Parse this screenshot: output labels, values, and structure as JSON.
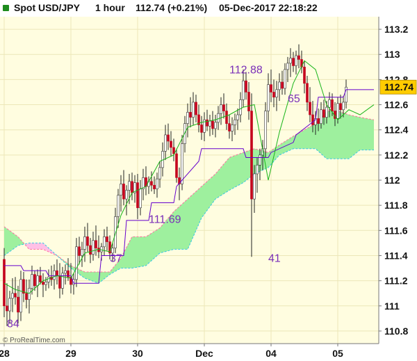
{
  "header": {
    "instrument": "Spot USD/JPY",
    "timeframe": "1 hour",
    "quote": "112.74 (+0.21%)",
    "datetime": "05-Dec-2017 22:18:22",
    "badge_color": "#1e8b1e"
  },
  "watermark": "© ProRealTime.com",
  "colors": {
    "background": "#fffde0",
    "bull": "#ffffff",
    "bear": "#c4001c",
    "tenkan": "#6600cc",
    "kijun": "#1ab51a",
    "cloud_bull": "#9ef09e",
    "cloud_bear": "#ffc0e6",
    "label": "#7a2fb8",
    "price_tag": "#ffcc00"
  },
  "chart_data": {
    "type": "candlestick",
    "ylim": [
      110.7,
      113.3
    ],
    "yticks": [
      113.2,
      113,
      112.8,
      112.6,
      112.4,
      112.2,
      112,
      111.8,
      111.6,
      111.4,
      111.2,
      111,
      110.8
    ],
    "xlabels": [
      {
        "text": "28",
        "i": 0
      },
      {
        "text": "29",
        "i": 24
      },
      {
        "text": "30",
        "i": 48
      },
      {
        "text": "Dec",
        "i": 72
      },
      {
        "text": "04",
        "i": 96
      },
      {
        "text": "05",
        "i": 120
      }
    ],
    "last_price": "112.74",
    "annotations": [
      {
        "text": "84",
        "i": 1,
        "y": 110.83
      },
      {
        "text": "37",
        "i": 38,
        "y": 111.35
      },
      {
        "text": "111.69",
        "i": 52,
        "y": 111.66
      },
      {
        "text": "112.88",
        "i": 81,
        "y": 112.85
      },
      {
        "text": "41",
        "i": 95,
        "y": 111.35
      },
      {
        "text": "65",
        "i": 102,
        "y": 112.62
      }
    ],
    "candles": [
      [
        111.37,
        111.46,
        110.91,
        111.0
      ],
      [
        111.0,
        111.18,
        110.84,
        110.96
      ],
      [
        110.96,
        111.12,
        110.86,
        111.06
      ],
      [
        111.06,
        111.22,
        110.95,
        111.1
      ],
      [
        111.1,
        111.23,
        111.01,
        111.07
      ],
      [
        111.07,
        111.16,
        110.86,
        110.95
      ],
      [
        110.95,
        111.28,
        110.88,
        111.21
      ],
      [
        111.21,
        111.27,
        111.03,
        111.1
      ],
      [
        111.1,
        111.21,
        110.98,
        111.05
      ],
      [
        111.05,
        111.21,
        110.94,
        111.14
      ],
      [
        111.14,
        111.32,
        111.09,
        111.25
      ],
      [
        111.25,
        111.28,
        111.12,
        111.16
      ],
      [
        111.16,
        111.29,
        111.07,
        111.24
      ],
      [
        111.24,
        111.31,
        111.17,
        111.19
      ],
      [
        111.19,
        111.26,
        111.07,
        111.17
      ],
      [
        111.17,
        111.23,
        111.12,
        111.19
      ],
      [
        111.19,
        111.29,
        111.14,
        111.23
      ],
      [
        111.23,
        111.32,
        111.16,
        111.21
      ],
      [
        111.21,
        111.33,
        111.13,
        111.28
      ],
      [
        111.28,
        111.37,
        111.17,
        111.24
      ],
      [
        111.24,
        111.34,
        111.06,
        111.14
      ],
      [
        111.14,
        111.31,
        111.09,
        111.26
      ],
      [
        111.26,
        111.33,
        111.17,
        111.28
      ],
      [
        111.28,
        111.38,
        111.2,
        111.23
      ],
      [
        111.23,
        111.34,
        111.1,
        111.17
      ],
      [
        111.17,
        111.26,
        111.09,
        111.21
      ],
      [
        111.21,
        111.54,
        111.15,
        111.47
      ],
      [
        111.47,
        111.55,
        111.33,
        111.4
      ],
      [
        111.4,
        111.51,
        111.31,
        111.45
      ],
      [
        111.45,
        111.63,
        111.35,
        111.55
      ],
      [
        111.55,
        111.66,
        111.43,
        111.48
      ],
      [
        111.48,
        111.54,
        111.34,
        111.41
      ],
      [
        111.41,
        111.59,
        111.36,
        111.52
      ],
      [
        111.52,
        111.64,
        111.4,
        111.46
      ],
      [
        111.46,
        111.56,
        111.38,
        111.43
      ],
      [
        111.43,
        111.5,
        111.36,
        111.47
      ],
      [
        111.47,
        111.61,
        111.4,
        111.55
      ],
      [
        111.55,
        111.63,
        111.44,
        111.51
      ],
      [
        111.51,
        111.56,
        111.37,
        111.42
      ],
      [
        111.42,
        111.5,
        111.35,
        111.46
      ],
      [
        111.46,
        111.78,
        111.42,
        111.71
      ],
      [
        111.71,
        111.93,
        111.62,
        111.88
      ],
      [
        111.88,
        112.04,
        111.75,
        111.97
      ],
      [
        111.97,
        112.08,
        111.8,
        111.85
      ],
      [
        111.85,
        111.96,
        111.72,
        111.92
      ],
      [
        111.92,
        112.05,
        111.81,
        111.99
      ],
      [
        111.99,
        112.06,
        111.84,
        111.9
      ],
      [
        111.9,
        112.04,
        111.82,
        111.98
      ],
      [
        111.98,
        112.05,
        111.69,
        111.78
      ],
      [
        111.78,
        112.0,
        111.72,
        111.93
      ],
      [
        111.93,
        112.09,
        111.84,
        112.02
      ],
      [
        112.02,
        112.11,
        111.88,
        111.95
      ],
      [
        111.95,
        112.03,
        111.89,
        111.99
      ],
      [
        111.99,
        112.07,
        111.91,
        111.96
      ],
      [
        111.96,
        112.03,
        111.89,
        111.93
      ],
      [
        111.93,
        112.06,
        111.86,
        112.01
      ],
      [
        112.01,
        112.15,
        111.94,
        112.1
      ],
      [
        112.1,
        112.3,
        112.03,
        112.23
      ],
      [
        112.23,
        112.44,
        112.16,
        112.36
      ],
      [
        112.36,
        112.45,
        112.24,
        112.31
      ],
      [
        112.31,
        112.39,
        112.19,
        112.26
      ],
      [
        112.26,
        112.33,
        112.15,
        112.21
      ],
      [
        112.21,
        112.25,
        111.98,
        112.02
      ],
      [
        112.02,
        112.1,
        111.84,
        111.97
      ],
      [
        111.97,
        112.36,
        111.92,
        112.29
      ],
      [
        112.29,
        112.51,
        112.22,
        112.45
      ],
      [
        112.45,
        112.61,
        112.34,
        112.54
      ],
      [
        112.54,
        112.66,
        112.42,
        112.5
      ],
      [
        112.5,
        112.7,
        112.44,
        112.62
      ],
      [
        112.62,
        112.68,
        112.46,
        112.52
      ],
      [
        112.52,
        112.6,
        112.38,
        112.44
      ],
      [
        112.44,
        112.51,
        112.32,
        112.38
      ],
      [
        112.38,
        112.54,
        112.31,
        112.48
      ],
      [
        112.48,
        112.56,
        112.39,
        112.43
      ],
      [
        112.43,
        112.52,
        112.35,
        112.47
      ],
      [
        112.47,
        112.55,
        112.36,
        112.41
      ],
      [
        112.41,
        112.52,
        112.34,
        112.46
      ],
      [
        112.46,
        112.59,
        112.4,
        112.53
      ],
      [
        112.53,
        112.66,
        112.44,
        112.6
      ],
      [
        112.6,
        112.69,
        112.49,
        112.55
      ],
      [
        112.55,
        112.61,
        112.4,
        112.45
      ],
      [
        112.45,
        112.52,
        112.33,
        112.39
      ],
      [
        112.39,
        112.5,
        112.31,
        112.44
      ],
      [
        112.44,
        112.53,
        112.36,
        112.48
      ],
      [
        112.48,
        112.57,
        112.4,
        112.52
      ],
      [
        112.52,
        112.7,
        112.46,
        112.64
      ],
      [
        112.64,
        112.88,
        112.58,
        112.79
      ],
      [
        112.79,
        112.86,
        112.64,
        112.7
      ],
      [
        112.7,
        112.78,
        112.48,
        112.55
      ],
      [
        112.55,
        112.69,
        111.39,
        111.85
      ],
      [
        111.85,
        112.12,
        111.74,
        112.05
      ],
      [
        112.05,
        112.18,
        111.9,
        112.12
      ],
      [
        112.12,
        112.25,
        112.0,
        112.2
      ],
      [
        112.2,
        112.32,
        112.08,
        112.25
      ],
      [
        112.25,
        112.62,
        112.18,
        112.55
      ],
      [
        112.55,
        112.85,
        112.46,
        112.76
      ],
      [
        112.76,
        112.88,
        112.62,
        112.7
      ],
      [
        112.7,
        112.8,
        112.58,
        112.66
      ],
      [
        112.66,
        112.79,
        112.55,
        112.72
      ],
      [
        112.72,
        112.85,
        112.63,
        112.78
      ],
      [
        112.78,
        112.87,
        112.68,
        112.73
      ],
      [
        112.73,
        112.93,
        112.68,
        112.88
      ],
      [
        112.88,
        112.98,
        112.78,
        112.93
      ],
      [
        112.93,
        113.05,
        112.82,
        112.97
      ],
      [
        112.97,
        113.02,
        112.86,
        112.91
      ],
      [
        112.91,
        113.03,
        112.84,
        112.99
      ],
      [
        112.99,
        113.08,
        112.89,
        112.96
      ],
      [
        112.96,
        113.03,
        112.85,
        112.9
      ],
      [
        112.9,
        112.95,
        112.69,
        112.77
      ],
      [
        112.77,
        112.83,
        112.55,
        112.62
      ],
      [
        112.62,
        112.74,
        112.46,
        112.52
      ],
      [
        112.52,
        112.63,
        112.38,
        112.44
      ],
      [
        112.44,
        112.55,
        112.36,
        112.49
      ],
      [
        112.49,
        112.57,
        112.39,
        112.45
      ],
      [
        112.45,
        112.62,
        112.41,
        112.56
      ],
      [
        112.56,
        112.64,
        112.44,
        112.5
      ],
      [
        112.5,
        112.63,
        112.45,
        112.58
      ],
      [
        112.58,
        112.7,
        112.5,
        112.64
      ],
      [
        112.64,
        112.69,
        112.51,
        112.55
      ],
      [
        112.55,
        112.62,
        112.43,
        112.49
      ],
      [
        112.49,
        112.66,
        112.45,
        112.61
      ],
      [
        112.61,
        112.68,
        112.49,
        112.56
      ],
      [
        112.56,
        112.67,
        112.5,
        112.62
      ],
      [
        112.62,
        112.8,
        112.57,
        112.74
      ]
    ],
    "tenkan": [
      [
        0,
        111.32
      ],
      [
        6,
        111.32
      ],
      [
        7,
        111.28
      ],
      [
        15,
        111.28
      ],
      [
        16,
        111.24
      ],
      [
        24,
        111.24
      ],
      [
        25,
        111.18
      ],
      [
        34,
        111.18
      ],
      [
        35,
        111.4
      ],
      [
        43,
        111.4
      ],
      [
        44,
        111.68
      ],
      [
        52,
        111.68
      ],
      [
        53,
        111.82
      ],
      [
        61,
        111.82
      ],
      [
        62,
        111.95
      ],
      [
        70,
        112.15
      ],
      [
        71,
        112.25
      ],
      [
        86,
        112.25
      ],
      [
        87,
        112.18
      ],
      [
        95,
        112.18
      ],
      [
        96,
        112.22
      ],
      [
        104,
        112.3
      ],
      [
        105,
        112.36
      ],
      [
        112,
        112.48
      ],
      [
        113,
        112.66
      ],
      [
        122,
        112.66
      ],
      [
        123,
        112.72
      ],
      [
        133,
        112.72
      ]
    ],
    "kijun": [
      [
        0,
        111.18
      ],
      [
        4,
        111.13
      ],
      [
        9,
        111.1
      ],
      [
        14,
        111.2
      ],
      [
        19,
        111.24
      ],
      [
        24,
        111.22
      ],
      [
        29,
        111.42
      ],
      [
        34,
        111.45
      ],
      [
        38,
        111.43
      ],
      [
        42,
        111.72
      ],
      [
        46,
        111.9
      ],
      [
        51,
        111.95
      ],
      [
        56,
        112.15
      ],
      [
        61,
        112.2
      ],
      [
        66,
        112.42
      ],
      [
        71,
        112.46
      ],
      [
        76,
        112.48
      ],
      [
        81,
        112.52
      ],
      [
        86,
        112.58
      ],
      [
        90,
        112.6
      ],
      [
        95,
        112.0
      ],
      [
        99,
        112.38
      ],
      [
        104,
        112.77
      ],
      [
        108,
        112.95
      ],
      [
        112,
        112.88
      ],
      [
        116,
        112.6
      ],
      [
        120,
        112.48
      ],
      [
        124,
        112.56
      ],
      [
        128,
        112.52
      ],
      [
        133,
        112.6
      ]
    ],
    "cloud": {
      "x": [
        0,
        5,
        9,
        14,
        19,
        24,
        29,
        34,
        38,
        42,
        46,
        51,
        56,
        61,
        66,
        71,
        76,
        81,
        86,
        90,
        95,
        99,
        104,
        108,
        112,
        116,
        120,
        124,
        128,
        133
      ],
      "span_a": [
        111.63,
        111.55,
        111.45,
        111.45,
        111.4,
        111.32,
        111.27,
        111.27,
        111.27,
        111.38,
        111.55,
        111.55,
        111.62,
        111.75,
        111.85,
        111.95,
        112.05,
        112.18,
        112.22,
        112.25,
        112.22,
        112.28,
        112.35,
        112.4,
        112.45,
        112.55,
        112.55,
        112.52,
        112.5,
        112.48
      ],
      "span_b": [
        111.4,
        111.48,
        111.5,
        111.5,
        111.4,
        111.3,
        111.22,
        111.18,
        111.25,
        111.3,
        111.3,
        111.32,
        111.42,
        111.45,
        111.45,
        111.7,
        111.85,
        111.92,
        111.98,
        112.05,
        112.1,
        112.2,
        112.25,
        112.25,
        112.25,
        112.17,
        112.17,
        112.17,
        112.24,
        112.24
      ]
    }
  }
}
